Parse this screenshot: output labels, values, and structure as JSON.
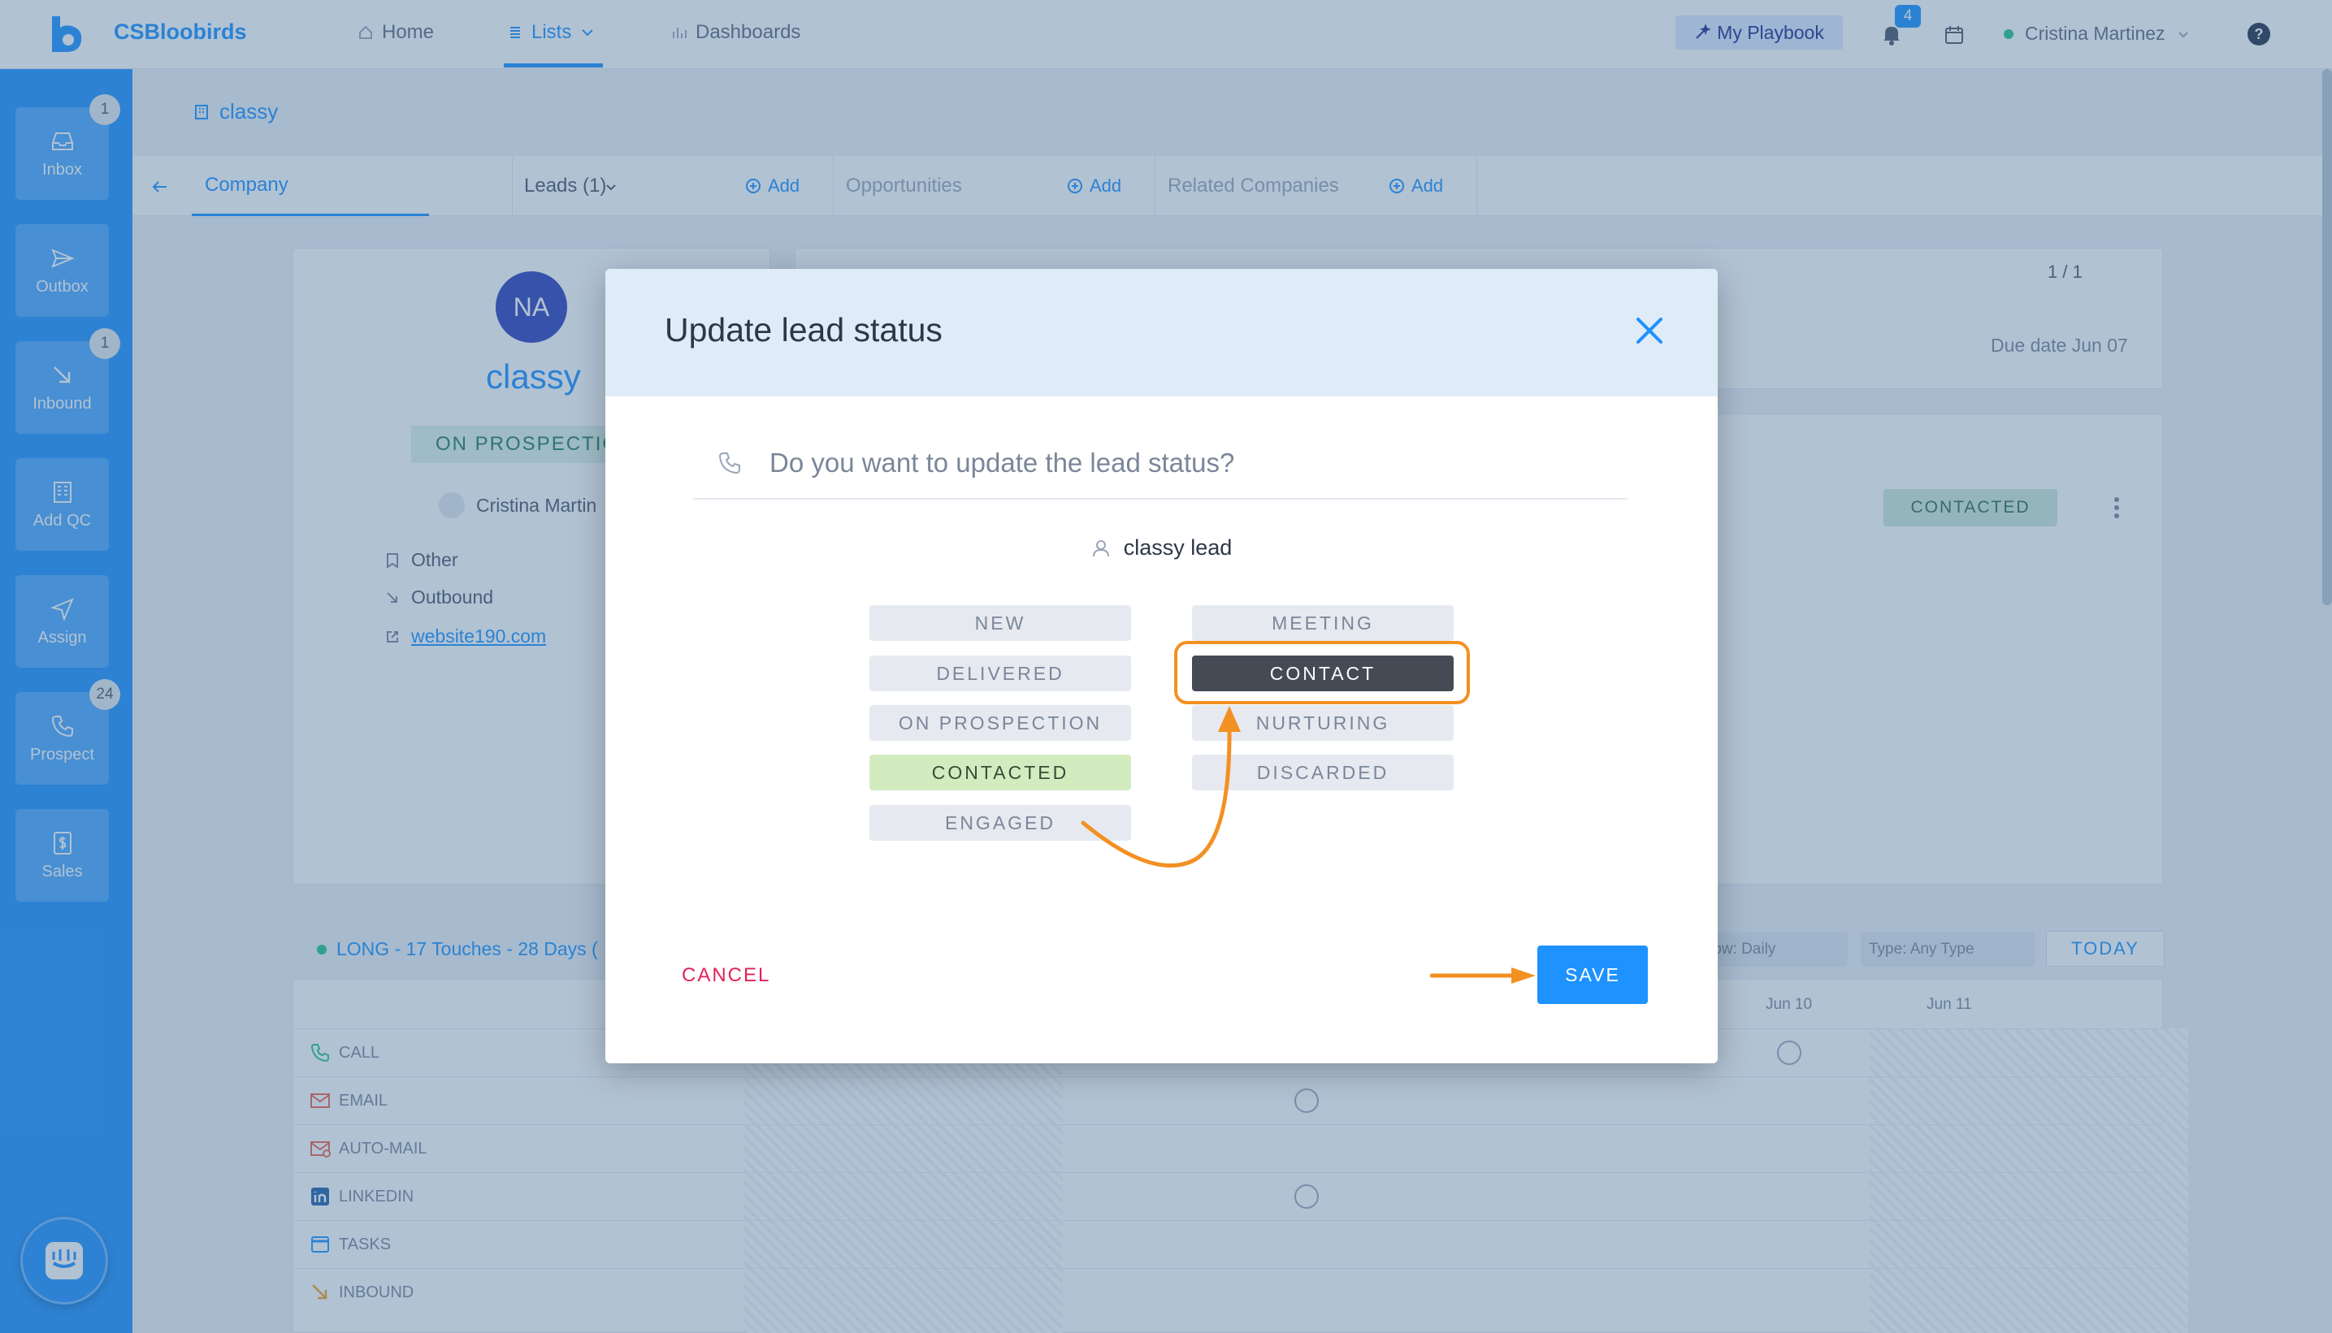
{
  "app": {
    "brand": "CSBloobirds"
  },
  "nav": {
    "home": "Home",
    "lists": "Lists",
    "dashboards": "Dashboards",
    "playbook": "My Playbook",
    "notifications_count": "4",
    "user_name": "Cristina Martinez",
    "help": "?"
  },
  "sidebar": {
    "items": [
      {
        "label": "Inbox",
        "badge": "1"
      },
      {
        "label": "Outbox",
        "badge": ""
      },
      {
        "label": "Inbound",
        "badge": "1"
      },
      {
        "label": "Add QC",
        "badge": ""
      },
      {
        "label": "Assign",
        "badge": ""
      },
      {
        "label": "Prospect",
        "badge": "24"
      },
      {
        "label": "Sales",
        "badge": ""
      }
    ]
  },
  "breadcrumb": {
    "company": "classy"
  },
  "tabs": {
    "company": "Company",
    "leads": "Leads (1)",
    "add": "Add",
    "opportunities": "Opportunities",
    "related": "Related Companies"
  },
  "company": {
    "initials": "NA",
    "name": "classy",
    "status": "ON PROSPECTIO",
    "owner": "Cristina Martin",
    "source": "Other",
    "channel": "Outbound",
    "website": "website190.com"
  },
  "tasks": {
    "pager": "1 / 1",
    "due": "Due date Jun 07"
  },
  "lead_card": {
    "status": "CONTACTED"
  },
  "cadence": {
    "title": "LONG - 17 Touches - 28 Days (",
    "view_filter": "low: Daily",
    "type_filter": "Type: Any Type",
    "today": "TODAY",
    "dates": [
      "Jun 10",
      "Jun 11"
    ],
    "rows": [
      "CALL",
      "EMAIL",
      "AUTO-MAIL",
      "LINKEDIN",
      "TASKS",
      "INBOUND"
    ]
  },
  "modal": {
    "title": "Update lead status",
    "question": "Do you want to update the lead status?",
    "lead_name": "classy lead",
    "statuses_left": [
      "NEW",
      "DELIVERED",
      "ON PROSPECTION",
      "CONTACTED",
      "ENGAGED"
    ],
    "statuses_right": [
      "MEETING",
      "CONTACT",
      "NURTURING",
      "DISCARDED"
    ],
    "current_status": "CONTACTED",
    "selected_status": "CONTACT",
    "cancel": "CANCEL",
    "save": "SAVE"
  },
  "colors": {
    "primary": "#1e92ff",
    "highlight": "#f39022",
    "danger": "#e2225a",
    "selected_dark": "#444b55",
    "current_green": "#d2ecc0"
  }
}
